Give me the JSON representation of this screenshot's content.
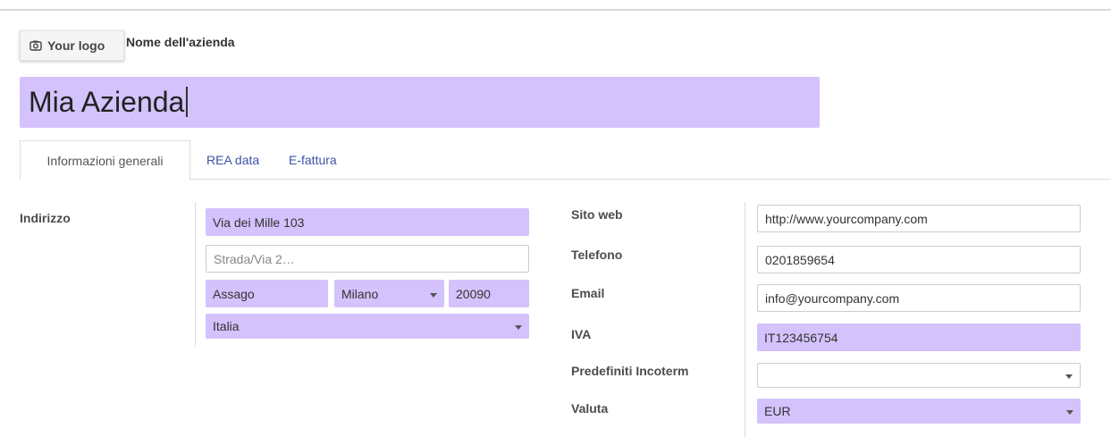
{
  "header": {
    "logo_label": "Your logo",
    "company_name_label": "Nome dell'azienda",
    "company_name_value": "Mia Azienda"
  },
  "tabs": [
    {
      "label": "Informazioni generali",
      "active": true
    },
    {
      "label": "REA data",
      "active": false
    },
    {
      "label": "E-fattura",
      "active": false
    }
  ],
  "address": {
    "label": "Indirizzo",
    "street": "Via dei Mille 103",
    "street2_placeholder": "Strada/Via 2…",
    "city": "Assago",
    "state": "Milano",
    "zip": "20090",
    "country": "Italia"
  },
  "right_fields": {
    "website_label": "Sito web",
    "website_value": "http://www.yourcompany.com",
    "phone_label": "Telefono",
    "phone_value": "0201859654",
    "email_label": "Email",
    "email_value": "info@yourcompany.com",
    "vat_label": "IVA",
    "vat_value": "IT123456754",
    "incoterm_label": "Predefiniti Incoterm",
    "incoterm_value": "",
    "currency_label": "Valuta",
    "currency_value": "EUR"
  },
  "colors": {
    "required_field_bg": "#d3c2fb",
    "link": "#3b54a8"
  },
  "icons": {
    "logo": "camera-icon",
    "dropdown": "caret-down-icon"
  }
}
